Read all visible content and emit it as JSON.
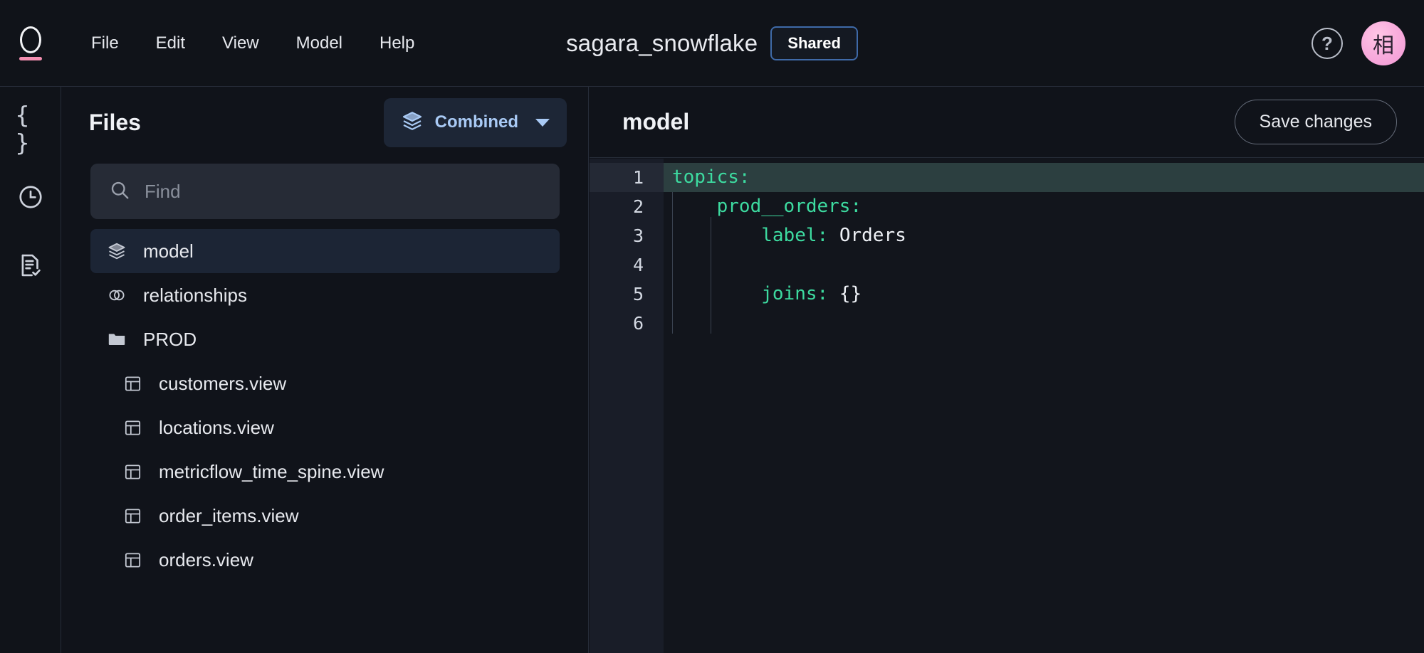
{
  "app": {
    "logo_icon": "omni-o-logo-icon",
    "menu": [
      "File",
      "Edit",
      "View",
      "Model",
      "Help"
    ]
  },
  "header": {
    "title": "sagara_snowflake",
    "badge": "Shared",
    "help_icon": "help-circle-icon",
    "help_glyph": "?",
    "avatar_initial": "相",
    "avatar_color": "#f9aedd",
    "accent_color": "#f48fb1"
  },
  "rail": {
    "items": [
      {
        "icon": "curly-braces-icon",
        "glyph": "{ }"
      },
      {
        "icon": "clock-history-icon"
      },
      {
        "icon": "document-check-icon"
      }
    ]
  },
  "files": {
    "title": "Files",
    "mode_selector": {
      "label": "Combined",
      "icon": "layers-stack-icon",
      "chevron": "chevron-down-icon",
      "text_color": "#a9caf5"
    },
    "search": {
      "placeholder": "Find",
      "value": "",
      "icon": "search-icon"
    },
    "items": [
      {
        "label": "model",
        "icon": "layers-stack-icon",
        "selected": true,
        "indent": false
      },
      {
        "label": "relationships",
        "icon": "link-chain-icon",
        "selected": false,
        "indent": false
      },
      {
        "label": "PROD",
        "icon": "folder-icon",
        "selected": false,
        "indent": false
      },
      {
        "label": "customers.view",
        "icon": "table-grid-icon",
        "selected": false,
        "indent": true
      },
      {
        "label": "locations.view",
        "icon": "table-grid-icon",
        "selected": false,
        "indent": true
      },
      {
        "label": "metricflow_time_spine.view",
        "icon": "table-grid-icon",
        "selected": false,
        "indent": true
      },
      {
        "label": "order_items.view",
        "icon": "table-grid-icon",
        "selected": false,
        "indent": true
      },
      {
        "label": "orders.view",
        "icon": "table-grid-icon",
        "selected": false,
        "indent": true
      }
    ]
  },
  "editor": {
    "title": "model",
    "save_label": "Save changes",
    "active_line": 1,
    "line_numbers": [
      "1",
      "2",
      "3",
      "4",
      "5",
      "6"
    ],
    "lines": [
      {
        "indent": 0,
        "key": "topics",
        "sep": ":",
        "value": "",
        "active": true
      },
      {
        "indent": 1,
        "key": "prod__orders",
        "sep": ":",
        "value": "",
        "active": false
      },
      {
        "indent": 2,
        "key": "label",
        "sep": ":",
        "value": "Orders",
        "active": false
      },
      {
        "indent": 0,
        "key": "",
        "sep": "",
        "value": "",
        "active": false
      },
      {
        "indent": 2,
        "key": "joins",
        "sep": ":",
        "value": "{}",
        "active": false
      },
      {
        "indent": 0,
        "key": "",
        "sep": "",
        "value": "",
        "active": false
      }
    ]
  }
}
